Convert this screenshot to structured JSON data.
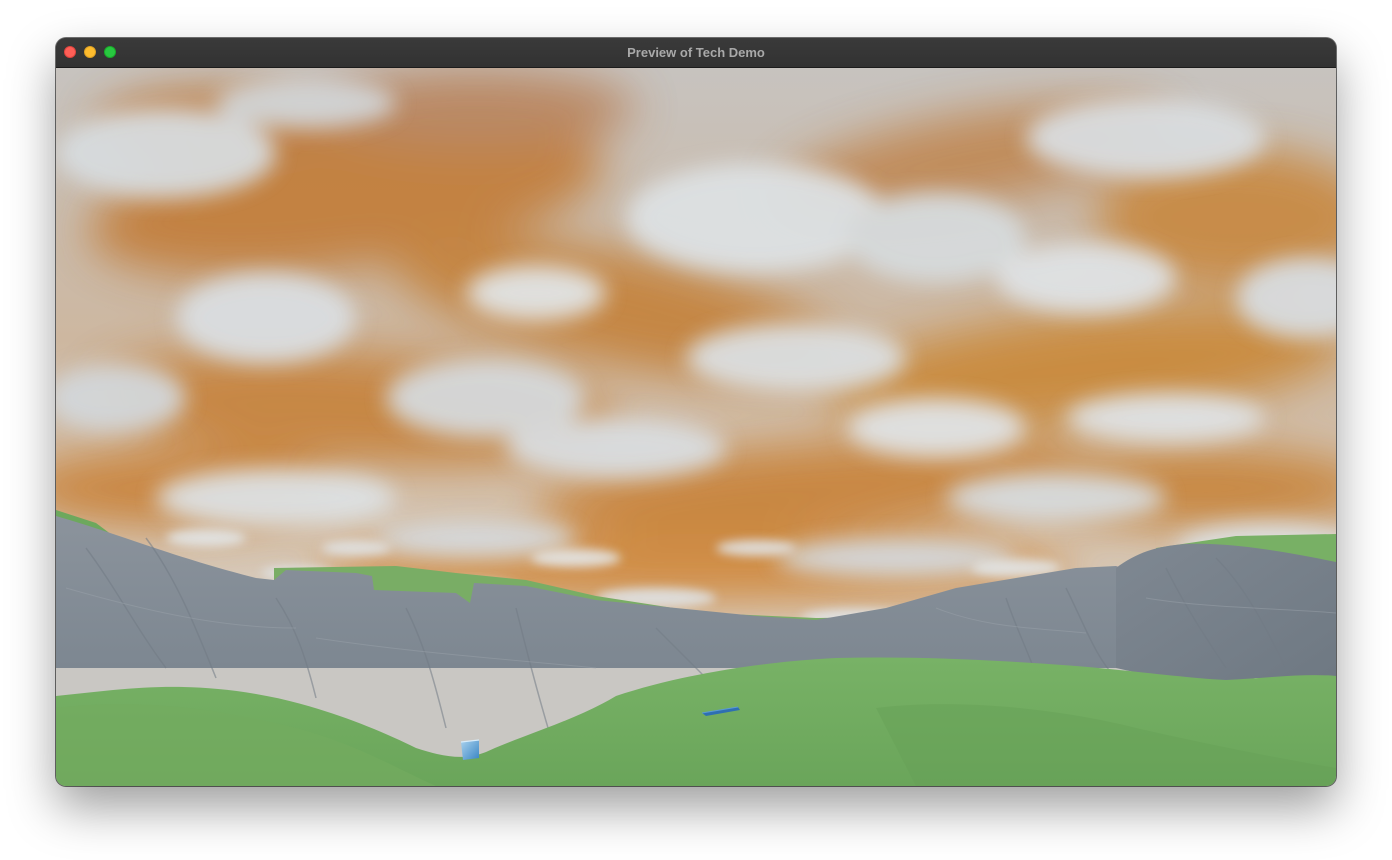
{
  "window": {
    "title": "Preview of Tech Demo",
    "controls": [
      "close",
      "minimize",
      "zoom"
    ]
  },
  "scene": {
    "description_colors": {
      "sky_orange": "#c98a45",
      "sky_cloud": "#d5dadc",
      "rock": "#838c96",
      "grass": "#74ae62"
    },
    "objects": [
      "sky-cloud-layer",
      "rock-ridge",
      "grass-foreground",
      "blue-crate",
      "blue-plank"
    ]
  }
}
